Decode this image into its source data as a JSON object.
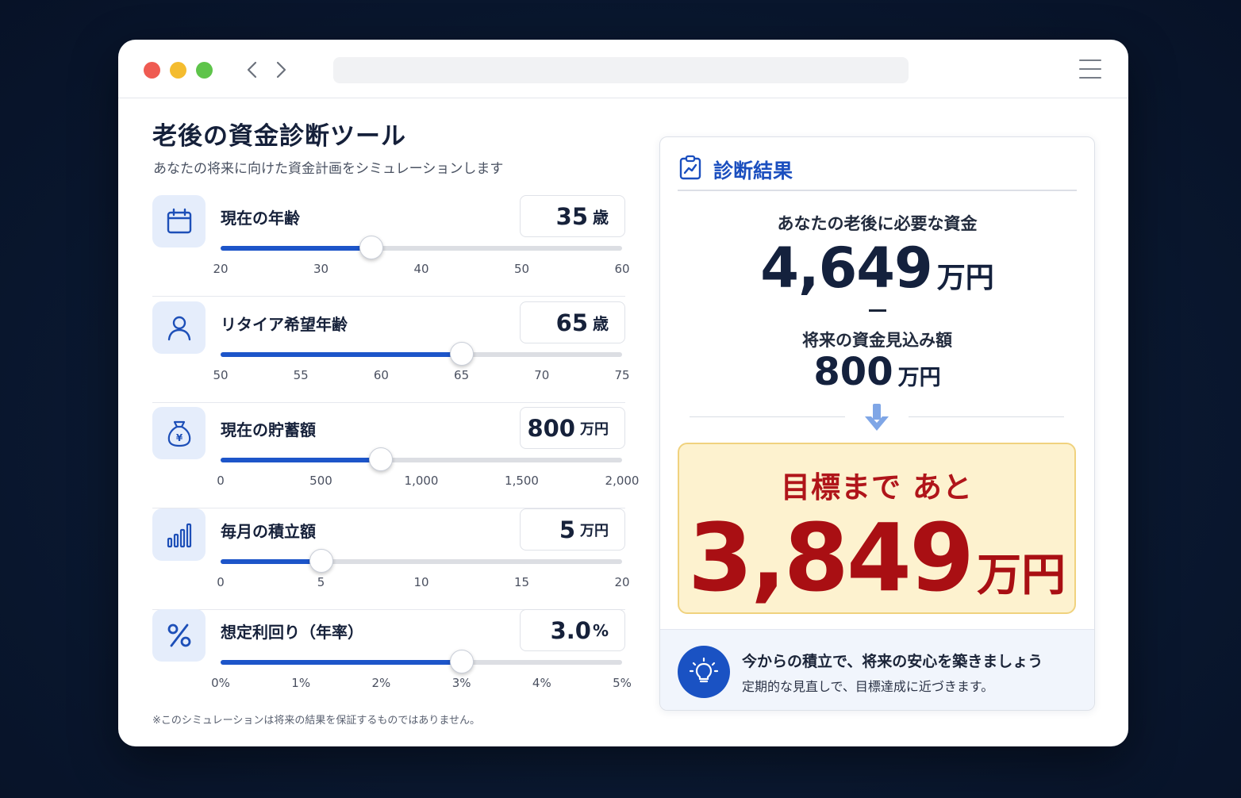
{
  "app": {
    "title": "老後の資金診断ツール",
    "subtitle": "あなたの将来に向けた資金計画をシミュレーションします",
    "disclaimer": "※このシミュレーションは将来の結果を保証するものではありません。"
  },
  "inputs": [
    {
      "label": "現在の年齢",
      "value": "35",
      "unit": "歳",
      "icon": "calendar-icon",
      "fill": 0.375,
      "ticks": [
        "20",
        "30",
        "40",
        "50",
        "60"
      ]
    },
    {
      "label": "リタイア希望年齢",
      "value": "65",
      "unit": "歳",
      "icon": "person-icon",
      "fill": 0.6,
      "ticks": [
        "50",
        "55",
        "60",
        "65",
        "70",
        "75"
      ]
    },
    {
      "label": "現在の貯蓄額",
      "value": "800",
      "unit": "万円",
      "icon": "money-bag-icon",
      "fill": 0.4,
      "ticks": [
        "0",
        "500",
        "1,000",
        "1,500",
        "2,000"
      ]
    },
    {
      "label": "毎月の積立額",
      "value": "5",
      "unit": "万円",
      "icon": "bar-chart-icon",
      "fill": 0.25,
      "ticks": [
        "0",
        "5",
        "10",
        "15",
        "20"
      ]
    },
    {
      "label": "想定利回り（年率）",
      "value": "3.0",
      "unit": "%",
      "icon": "percent-icon",
      "fill": 0.6,
      "ticks": [
        "0%",
        "1%",
        "2%",
        "3%",
        "4%",
        "5%"
      ]
    }
  ],
  "result": {
    "title": "診断結果",
    "need_label": "あなたの老後に必要な資金",
    "need_value": "4,649",
    "need_unit": "万円",
    "future_label": "将来の資金見込み額",
    "future_value": "800",
    "future_unit": "万円",
    "target_label": "目標まで あと",
    "target_value": "3,849",
    "target_unit": "万円",
    "tip_title": "今からの積立で、将来の安心を築きましょう",
    "tip_sub": "定期的な見直しで、目標達成に近づきます。"
  },
  "colors": {
    "accent": "#1d55c9",
    "target_text": "#b0151a",
    "target_bg": "#fdf2cf",
    "background": "#0b1a33"
  }
}
